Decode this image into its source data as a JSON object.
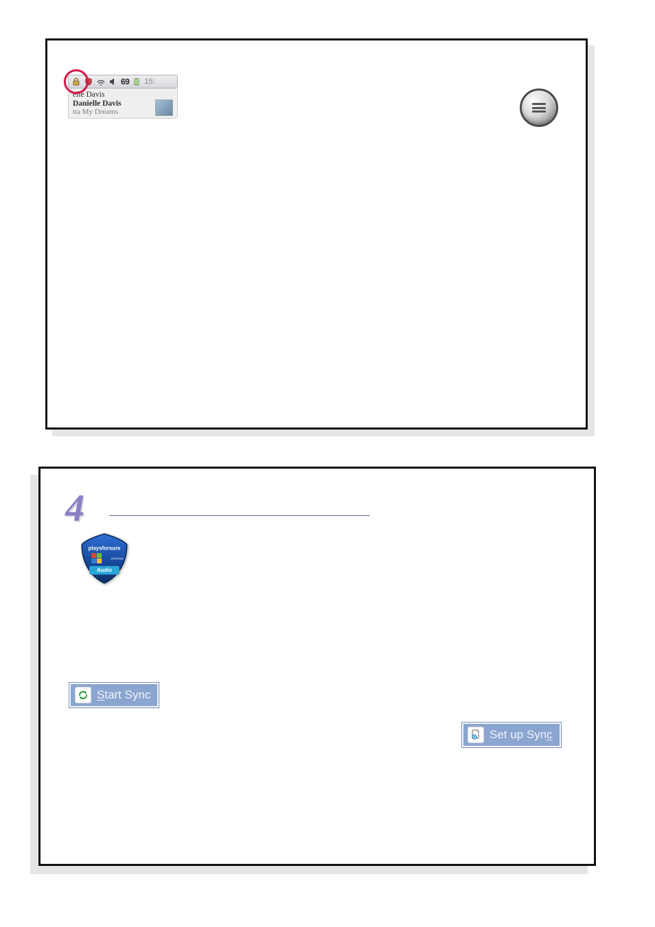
{
  "panel1": {
    "tray": {
      "lock_icon_name": "lock-icon",
      "shield_icon_name": "shield-small-icon",
      "wifi_icon_name": "wifi-icon",
      "speaker_icon_name": "speaker-icon",
      "number_label": "69",
      "battery_icon_name": "battery-icon",
      "time_label": "15:"
    },
    "now_playing": {
      "line1": "elle Davis",
      "line2": "Danielle Davis",
      "line3": "tta My Dreams"
    },
    "round_button_name": "menu-round-icon"
  },
  "panel2": {
    "step_number": "4",
    "playsforsure": {
      "top_text": "playsforsure",
      "bottom_text": "Audio"
    },
    "start_sync": {
      "label_before": "",
      "label_underline": "S",
      "label_after": "tart Sync"
    },
    "setup_sync": {
      "label_before": "Set up Syn",
      "label_underline": "c",
      "label_after": ""
    }
  }
}
